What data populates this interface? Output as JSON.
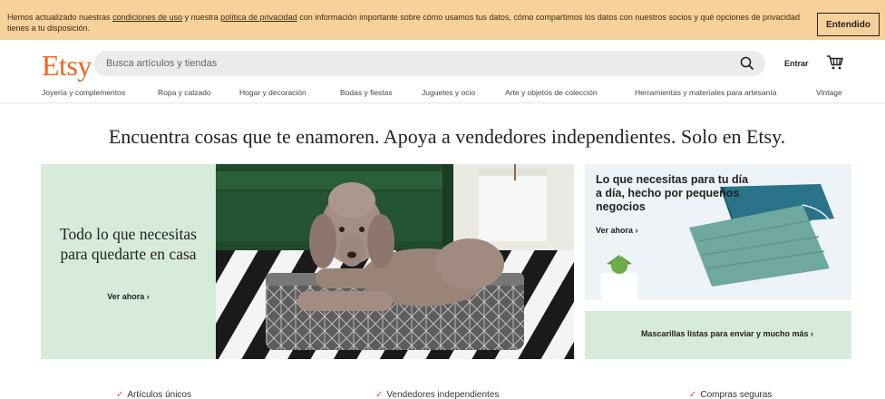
{
  "banner": {
    "text_1": "Hemos actualizado nuestras ",
    "terms_link": "condiciones de uso",
    "text_2": " y nuestra ",
    "privacy_link": "política de privacidad",
    "text_3": " con información importante sobre cómo usamos tus datos, cómo compartimos los datos con nuestros socios y qué opciones de privacidad tienes a tu disposición.",
    "accept_label": "Entendido"
  },
  "header": {
    "logo": "Etsy",
    "search_placeholder": "Busca artículos y tiendas",
    "signin_label": "Entrar"
  },
  "categories": [
    "Joyería y complementos",
    "Ropa y calzado",
    "Hogar y decoración",
    "Bodas y fiestas",
    "Juguetes y ocio",
    "Arte y objetos de colección",
    "Herramientas y materiales para artesanía",
    "Vintage"
  ],
  "main": {
    "tagline": "Encuentra cosas que te enamoren. Apoya a vendedores independientes. Solo en Etsy.",
    "hero": {
      "title": "Todo lo que necesitas para quedarte en casa",
      "link": "Ver ahora ›"
    },
    "card_top": {
      "title": "Lo que necesitas para tu día a día, hecho por pequeños negocios",
      "link": "Ver ahora ›"
    },
    "card_bottom": {
      "link": "Mascarillas listas para enviar y mucho más ›"
    },
    "values": [
      "Artículos únicos",
      "Vendedores independientes",
      "Compras seguras"
    ]
  },
  "colors": {
    "brand": "#f1641e",
    "banner_bg": "#f6d19a",
    "hero_bg": "#d7ebdb"
  }
}
